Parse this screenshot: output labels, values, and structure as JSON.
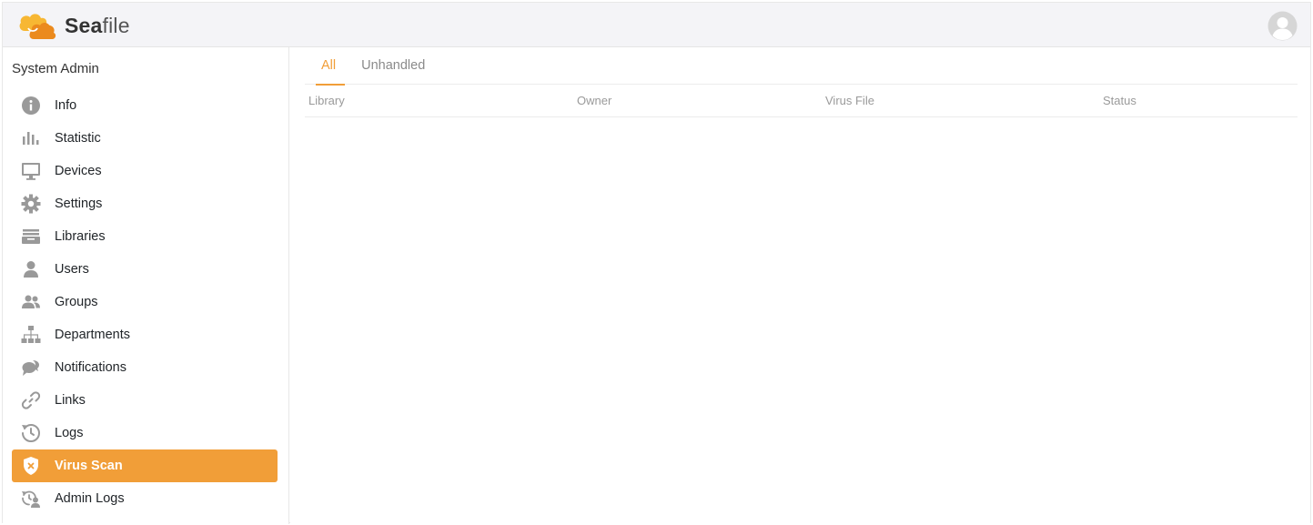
{
  "header": {
    "logo_text_bold": "Sea",
    "logo_text_rest": "file",
    "avatar_icon": "user-circle-icon"
  },
  "sidebar": {
    "title": "System Admin",
    "items": [
      {
        "label": "Info",
        "icon": "info-icon",
        "active": false
      },
      {
        "label": "Statistic",
        "icon": "bar-chart-icon",
        "active": false
      },
      {
        "label": "Devices",
        "icon": "monitor-icon",
        "active": false
      },
      {
        "label": "Settings",
        "icon": "gear-icon",
        "active": false
      },
      {
        "label": "Libraries",
        "icon": "libraries-icon",
        "active": false
      },
      {
        "label": "Users",
        "icon": "user-icon",
        "active": false
      },
      {
        "label": "Groups",
        "icon": "group-icon",
        "active": false
      },
      {
        "label": "Departments",
        "icon": "org-chart-icon",
        "active": false
      },
      {
        "label": "Notifications",
        "icon": "chat-bubbles-icon",
        "active": false
      },
      {
        "label": "Links",
        "icon": "link-icon",
        "active": false
      },
      {
        "label": "Logs",
        "icon": "history-icon",
        "active": false
      },
      {
        "label": "Virus Scan",
        "icon": "shield-x-icon",
        "active": true
      },
      {
        "label": "Admin Logs",
        "icon": "admin-logs-icon",
        "active": false
      }
    ]
  },
  "main": {
    "tabs": [
      {
        "label": "All",
        "active": true
      },
      {
        "label": "Unhandled",
        "active": false
      }
    ],
    "table": {
      "columns": [
        "Library",
        "Owner",
        "Virus File",
        "Status"
      ],
      "rows": []
    }
  },
  "colors": {
    "accent": "#f19e38",
    "icon_gray": "#999999",
    "header_bg": "#f4f4f7"
  }
}
